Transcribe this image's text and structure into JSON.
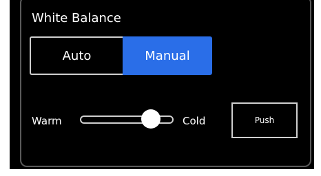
{
  "white_balance": {
    "title": "White Balance",
    "mode_options": [
      "Auto",
      "Manual"
    ],
    "selected_mode": "Manual",
    "slider": {
      "left_label": "Warm",
      "right_label": "Cold",
      "value": 0.76
    },
    "push_label": "Push"
  },
  "colors": {
    "panel_bg": "#000000",
    "selected_accent": "#2a6ee8",
    "text": "#ffffff",
    "outline": "#cfcfcf"
  }
}
